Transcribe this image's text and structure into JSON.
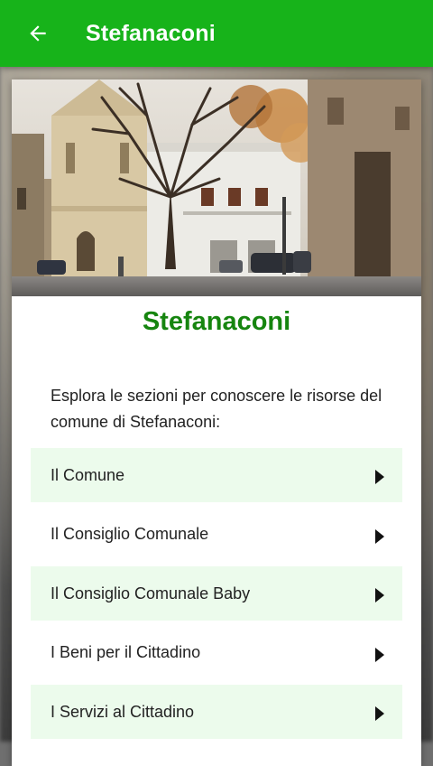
{
  "appbar": {
    "title": "Stefanaconi",
    "back_icon": "arrow-left-icon",
    "color": "#17b31a"
  },
  "hero": {
    "image": "town-square-photo"
  },
  "card": {
    "title": "Stefanaconi",
    "title_color": "#16850f",
    "intro": "Esplora le sezioni per conoscere le risorse del comune di Stefanaconi:"
  },
  "menu": {
    "arrow_icon": "triangle-right-icon",
    "items": [
      {
        "label": "Il Comune"
      },
      {
        "label": "Il Consiglio Comunale"
      },
      {
        "label": "Il Consiglio Comunale Baby"
      },
      {
        "label": "I Beni per il Cittadino"
      },
      {
        "label": "I Servizi al Cittadino"
      }
    ]
  }
}
